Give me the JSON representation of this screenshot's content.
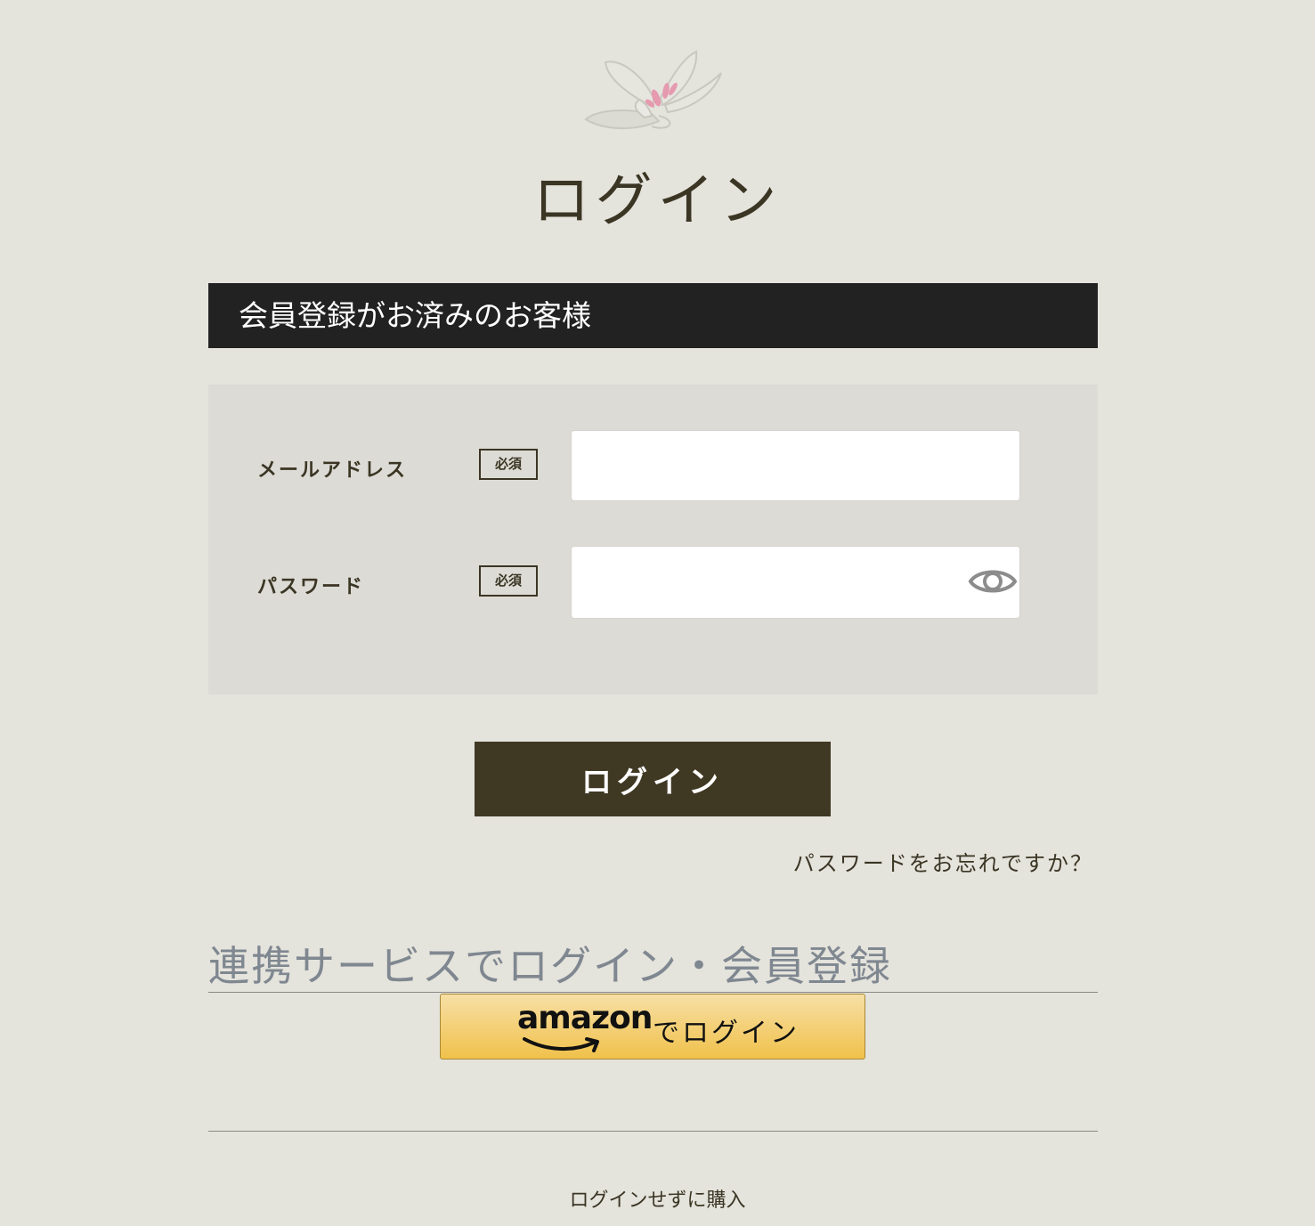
{
  "header": {
    "logo_icon": "lily-flower-icon",
    "title": "ログイン"
  },
  "member_section": {
    "heading": "会員登録がお済みのお客様",
    "fields": {
      "email": {
        "label": "メールアドレス",
        "required_badge": "必須",
        "value": "",
        "placeholder": ""
      },
      "password": {
        "label": "パスワード",
        "required_badge": "必須",
        "value": "",
        "placeholder": "",
        "toggle_icon": "eye-icon"
      }
    },
    "login_button": "ログイン",
    "forgot_password": "パスワードをお忘れですか？"
  },
  "linked_services": {
    "heading": "連携サービスでログイン・会員登録",
    "amazon": {
      "wordmark": "amazon",
      "suffix": "でログイン",
      "gradient_top": "#f7dfa5",
      "gradient_bottom": "#f0c14b"
    }
  },
  "guest": {
    "link": "ログインせずに購入"
  },
  "colors": {
    "background": "#e4e3dc",
    "header_bar": "#222222",
    "panel": "#dcdbd5",
    "primary_button": "#3f3823",
    "text": "#3b3524",
    "muted_heading": "#7f8790"
  }
}
